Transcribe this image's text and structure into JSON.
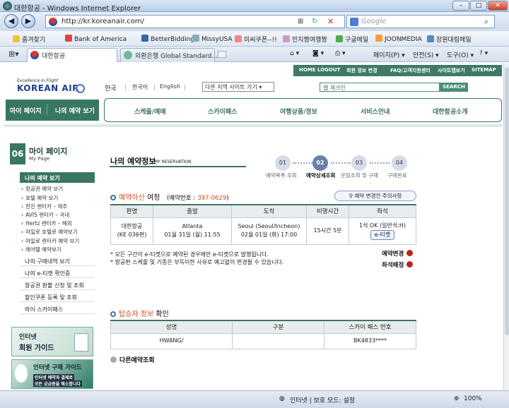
{
  "window": {
    "title": "대한항공 - Windows Internet Explorer",
    "min": "–",
    "max": "□",
    "close": "✕"
  },
  "address": {
    "url": "http://kr.koreanair.com/",
    "search_placeholder": "Google"
  },
  "favorites": {
    "label": "즐겨찾기",
    "items": [
      "Bank of America",
      "BetterBidding",
      "MissyUSA",
      "미씨쿠폰--!!",
      "민지짱여행짱",
      "구글메일",
      "JOONMEDIA",
      "장원대림메일"
    ]
  },
  "tabs": [
    {
      "label": "대한항공"
    },
    {
      "label": "외환은행 Global Standard..."
    }
  ],
  "tools": {
    "page": "페이지(P) ▾",
    "safety": "안전(S) ▾",
    "tools": "도구(O) ▾",
    "help": "? ▾"
  },
  "site": {
    "toplinks": [
      "HOME",
      "LOGOUT",
      "회원 정보 변경",
      "FAQ/고객지원센터",
      "사이트맵보기",
      "SITEMAP"
    ],
    "logo_tagline": "Excellence in Flight",
    "logo_name": "KOREAN AIR",
    "lang": {
      "ko": "한국",
      "kr": "한국어",
      "en": "English"
    },
    "site_select": "다른 지역 사이트 가기 ▾",
    "search_placeholder": "웹 체크인",
    "search_btn": "SEARCH",
    "mypage_tab": [
      "마이 페이지",
      "나의 예약 보기"
    ],
    "nav": [
      "스케줄/예매",
      "스카이패스",
      "여행상품/정보",
      "서비스안내",
      "대한항공소개"
    ]
  },
  "sidebar": {
    "num": "06",
    "title": "마이 페이지",
    "subtitle": "My Page",
    "active": "나의 예약 보기",
    "subitems": [
      "항공권 예약 보기",
      "호텔 예약 보기",
      "한진 렌터카 – 제주",
      "AVIS 렌터카 – 국내",
      "Hertz 렌터카 – 해외",
      "마일로 호텔로 예약보기",
      "마일로 렌터카 예약 보기",
      "에어텔 예약보기"
    ],
    "items": [
      "나의 구매내역 보기",
      "나의 e-티켓 확인증",
      "항공권 환불 신청 및 조회",
      "할인쿠폰 등록 및 조회",
      "마이 스카이패스"
    ],
    "banner1": [
      "인터넷",
      "회원 가이드"
    ],
    "banner2": [
      "인터넷 구매 가이드",
      "인터넷 예약과 결제로",
      "모든 궁금증을 해소합니다"
    ]
  },
  "content": {
    "title": "나의 예약정보",
    "title_en": "MY RESERVATION",
    "steps": [
      {
        "num": "01",
        "label": "예약목록 조회"
      },
      {
        "num": "02",
        "label": "예약상세조회"
      },
      {
        "num": "03",
        "label": "운임조회 및 구매"
      },
      {
        "num": "04",
        "label": "구매완료"
      }
    ],
    "itinerary_label_hl": "예약하신",
    "itinerary_label": "여정",
    "booking_prefix": "(예약번호 :",
    "booking_no": "397-0629",
    "booking_suffix": ")",
    "notice_btn": "예약 변경전 주의사항",
    "flight_headers": [
      "편명",
      "출발",
      "도착",
      "비행시간",
      "좌석"
    ],
    "flight": {
      "airline": "대한항공",
      "flight_no": "(KE 036편)",
      "dep_city": "Atlanta",
      "dep_time": "01월 31일 (월)  11:55",
      "arr_city": "Seoul (Seoul/Incheon)",
      "arr_time": "02월 01일 (화)  17:00",
      "duration": "15시간 5분",
      "seat_status": "1석 OK (일반석:H)",
      "eticket": "e-티켓"
    },
    "notes": [
      "* 모든 구간이 e-티켓으로 예약된 경우에만 e-티켓으로 발행됩니다.",
      "* 항공편 스케줄 및 기종은 부득이한 사유로 예고없이 변경될 수 있습니다."
    ],
    "change_link": "예약변경",
    "seat_link": "좌석배정",
    "passenger_label_hl": "탑승자 정보",
    "passenger_label": "확인",
    "pax_headers": [
      "성명",
      "구분",
      "스카이 패스 번호"
    ],
    "pax": {
      "name": "HWANG/",
      "type": "",
      "skypass": "BK4833****"
    },
    "other_link": "다른예약조회"
  },
  "status": {
    "zone": "인터넷 | 보호 모드: 설정",
    "zoom": "100%"
  }
}
